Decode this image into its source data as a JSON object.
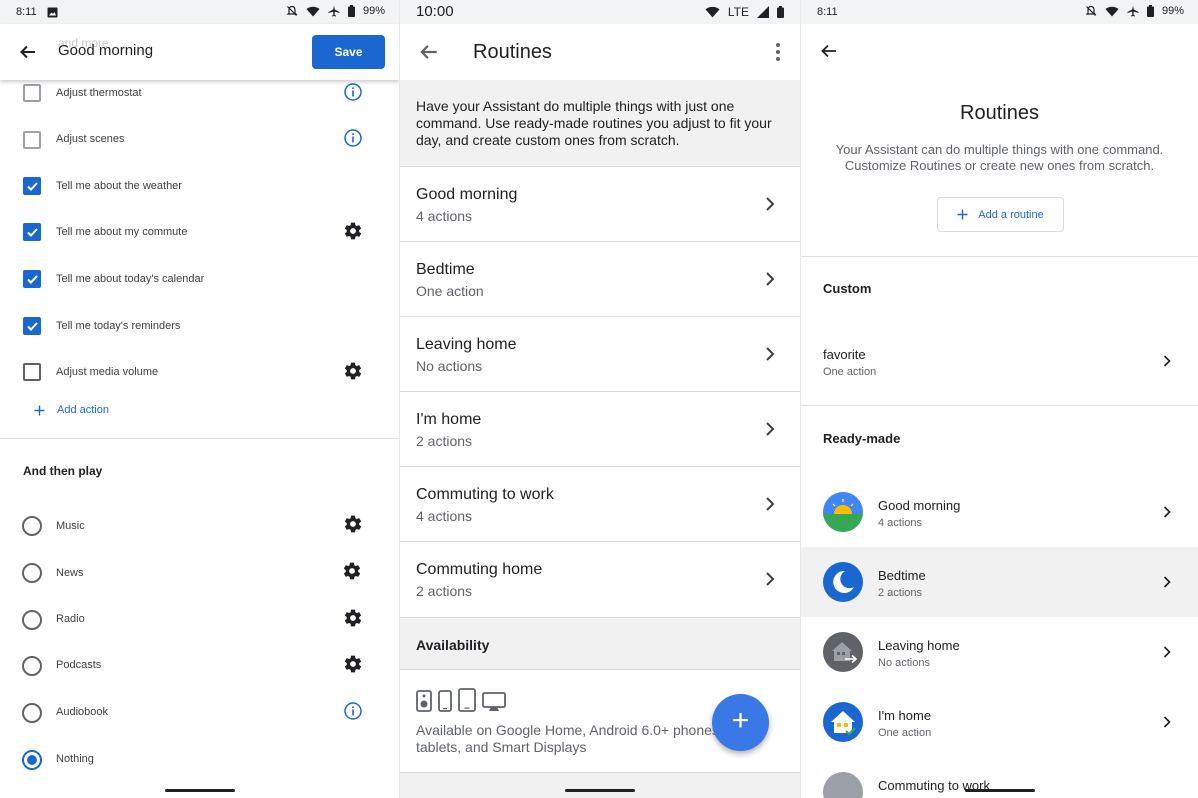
{
  "colors": {
    "accent": "#1a67d2",
    "fab": "#3b78e7",
    "section_bg": "#f1f1f1"
  },
  "left_screen": {
    "status": {
      "time": "8:11",
      "battery": "99%"
    },
    "header": {
      "ghost_text": "and more",
      "title": "Good morning",
      "save_label": "Save"
    },
    "actions": [
      {
        "label": "Adjust thermostat",
        "checked": false,
        "trailing": "info-icon"
      },
      {
        "label": "Adjust scenes",
        "checked": false,
        "trailing": "info-icon"
      },
      {
        "label": "Tell me about the weather",
        "checked": true,
        "trailing": ""
      },
      {
        "label": "Tell me about my commute",
        "checked": true,
        "trailing": "gear-icon"
      },
      {
        "label": "Tell me about today's calendar",
        "checked": true,
        "trailing": ""
      },
      {
        "label": "Tell me today's reminders",
        "checked": true,
        "trailing": ""
      },
      {
        "label": "Adjust media volume",
        "checked": false,
        "trailing": "gear-icon"
      }
    ],
    "add_action": "Add action",
    "and_then_play": "And then play",
    "media": [
      {
        "label": "Music",
        "selected": false,
        "trailing": "gear-icon"
      },
      {
        "label": "News",
        "selected": false,
        "trailing": "gear-icon"
      },
      {
        "label": "Radio",
        "selected": false,
        "trailing": "gear-icon"
      },
      {
        "label": "Podcasts",
        "selected": false,
        "trailing": "gear-icon"
      },
      {
        "label": "Audiobook",
        "selected": false,
        "trailing": "info-icon"
      },
      {
        "label": "Nothing",
        "selected": true,
        "trailing": ""
      }
    ]
  },
  "middle_screen": {
    "status": {
      "time": "10:00",
      "network": "LTE"
    },
    "title": "Routines",
    "intro": "Have your Assistant do multiple things with just one command. Use ready-made routines you adjust to fit your day, and create custom ones from scratch.",
    "routines": [
      {
        "title": "Good morning",
        "subtitle": "4 actions"
      },
      {
        "title": "Bedtime",
        "subtitle": "One action"
      },
      {
        "title": "Leaving home",
        "subtitle": "No actions"
      },
      {
        "title": "I'm home",
        "subtitle": "2 actions"
      },
      {
        "title": "Commuting to work",
        "subtitle": "4 actions"
      },
      {
        "title": "Commuting home",
        "subtitle": "2 actions"
      }
    ],
    "availability_title": "Availability",
    "availability_text": "Available on Google Home, Android 6.0+ phones, tablets, and Smart Displays",
    "fab_label": "+"
  },
  "right_screen": {
    "status": {
      "time": "8:11",
      "battery": "99%"
    },
    "title": "Routines",
    "description": "Your Assistant can do multiple things with one command. Customize Routines or create new ones from scratch.",
    "add_routine": "Add a routine",
    "custom_title": "Custom",
    "custom": {
      "title": "favorite",
      "subtitle": "One action"
    },
    "ready_made_title": "Ready-made",
    "ready_made": [
      {
        "title": "Good morning",
        "subtitle": "4 actions",
        "icon": "sunrise-icon"
      },
      {
        "title": "Bedtime",
        "subtitle": "2 actions",
        "icon": "moon-icon"
      },
      {
        "title": "Leaving home",
        "subtitle": "No actions",
        "icon": "leaving-home-icon"
      },
      {
        "title": "I'm home",
        "subtitle": "One action",
        "icon": "home-check-icon"
      },
      {
        "title": "Commuting to work",
        "subtitle": "",
        "icon": "commute-icon"
      }
    ]
  }
}
